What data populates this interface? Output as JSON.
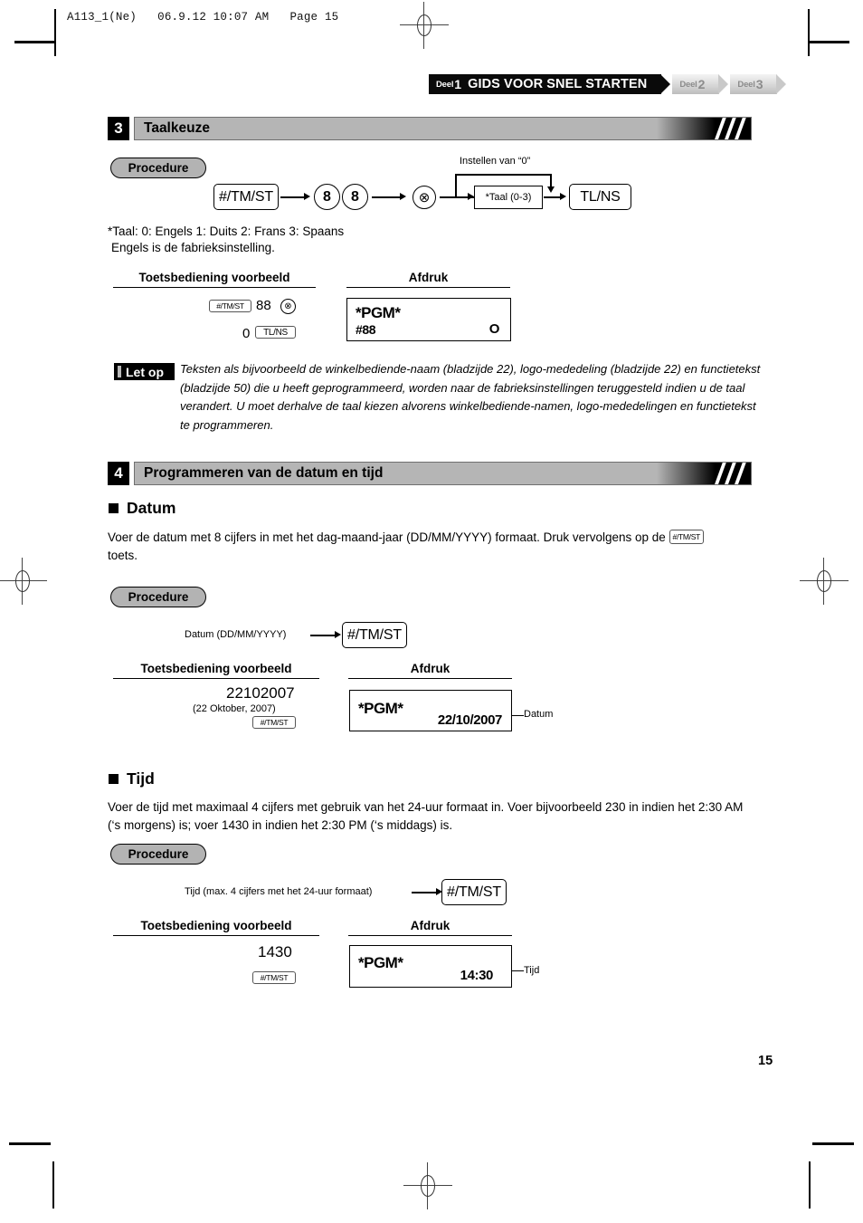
{
  "print_header": "A113_1(Ne)   06.9.12 10:07 AM   Page 15",
  "page_number": "15",
  "chapter_tabs": [
    {
      "deel": "Deel",
      "num": "1",
      "title": "GIDS VOOR SNEL STARTEN",
      "active": true
    },
    {
      "deel": "Deel",
      "num": "2",
      "title": "",
      "active": false
    },
    {
      "deel": "Deel",
      "num": "3",
      "title": "",
      "active": false
    }
  ],
  "section3": {
    "number": "3",
    "title": "Taalkeuze",
    "procedure_label": "Procedure",
    "branch_label": "Instellen van “0”",
    "flow": {
      "key1": "#/TM/ST",
      "digit1": "8",
      "digit2": "8",
      "multiply": "⊗",
      "param_box": "*Taal (0-3)",
      "key_end": "TL/NS"
    },
    "footnote_line1": "*Taal: 0: Engels     1: Duits     2: Frans     3: Spaans",
    "footnote_line2": "Engels is de fabrieksinstelling.",
    "example": {
      "col_left": "Toetsbediening voorbeeld",
      "col_right": "Afdruk",
      "keys_line1_key": "#/TM/ST",
      "keys_line1_digits": "88",
      "keys_line1_mult": "⊗",
      "keys_line2_digit": "0",
      "keys_line2_key": "TL/NS",
      "receipt": {
        "line1": "*PGM*",
        "line2_left": "#88",
        "line2_right": "O"
      }
    },
    "note": {
      "badge": "Let op",
      "text": "Teksten als bijvoorbeeld de winkelbediende-naam (bladzijde 22), logo-mededeling (bladzijde 22) en functietekst (bladzijde 50) die u heeft geprogrammeerd, worden naar de fabrieksinstellingen teruggesteld indien u de taal verandert. U moet derhalve de taal kiezen alvorens winkelbediende-namen, logo-mededelingen en functietekst te programmeren."
    }
  },
  "section4": {
    "number": "4",
    "title": "Programmeren van de datum en tijd",
    "datum": {
      "heading": "Datum",
      "body_part1": "Voer de datum met 8 cijfers in met het dag-maand-jaar (DD/MM/YYYY) formaat. Druk vervolgens op de ",
      "body_key": "#/TM/ST",
      "body_part2": "toets.",
      "procedure_label": "Procedure",
      "flow_input_label": "Datum (DD/MM/YYYY)",
      "flow_key": "#/TM/ST",
      "example": {
        "col_left": "Toetsbediening voorbeeld",
        "col_right": "Afdruk",
        "entry": "22102007",
        "entry_note": "(22 Oktober, 2007)",
        "entry_key": "#/TM/ST",
        "receipt": {
          "line1": "*PGM*",
          "line2_right": "22/10/2007"
        },
        "callout": "Datum"
      }
    },
    "tijd": {
      "heading": "Tijd",
      "body": "Voer de tijd met maximaal 4 cijfers met gebruik van het 24-uur formaat in. Voer bijvoorbeeld 230 in indien het 2:30 AM (‘s morgens) is; voer 1430 in indien het 2:30 PM (‘s middags) is.",
      "procedure_label": "Procedure",
      "flow_input_label": "Tijd (max. 4 cijfers met het 24-uur formaat)",
      "flow_key": "#/TM/ST",
      "example": {
        "col_left": "Toetsbediening voorbeeld",
        "col_right": "Afdruk",
        "entry": "1430",
        "entry_key": "#/TM/ST",
        "receipt": {
          "line1": "*PGM*",
          "line2_right": "14:30"
        },
        "callout": "Tijd"
      }
    }
  }
}
